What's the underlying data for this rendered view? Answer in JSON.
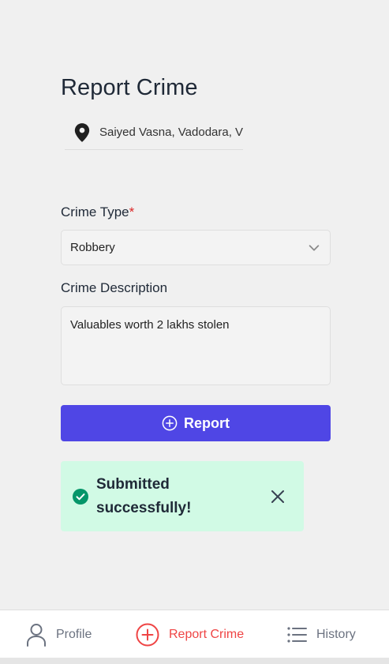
{
  "page": {
    "title": "Report Crime"
  },
  "location": {
    "text": "Saiyed Vasna, Vadodara, V",
    "icon": "map-pin-icon"
  },
  "form": {
    "crime_type_label": "Crime Type",
    "required_marker": "*",
    "crime_type_value": "Robbery",
    "description_label": "Crime Description",
    "description_value": "Valuables worth 2 lakhs stolen"
  },
  "report_button": {
    "label": "Report",
    "icon": "plus-circle-icon",
    "color": "#4f46e5"
  },
  "toast": {
    "message": "Submitted successfully!",
    "background": "#d1fae5",
    "icon": "check-circle-icon",
    "close_icon": "close-icon"
  },
  "nav": {
    "items": [
      {
        "label": "Profile",
        "icon": "user-icon",
        "active": false
      },
      {
        "label": "Report Crime",
        "icon": "plus-circle-icon",
        "active": true
      },
      {
        "label": "History",
        "icon": "list-icon",
        "active": false
      }
    ],
    "active_color": "#ef4444",
    "inactive_color": "#6b7280"
  }
}
